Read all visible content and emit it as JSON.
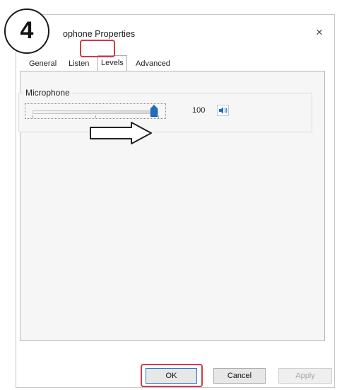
{
  "step_badge": "4",
  "dialog": {
    "title": "ophone Properties",
    "close_label": "×"
  },
  "tabs": [
    {
      "label": "General"
    },
    {
      "label": "Listen"
    },
    {
      "label": "Levels",
      "selected": true
    },
    {
      "label": "Advanced"
    }
  ],
  "levels": {
    "group_label": "Microphone",
    "slider_value": 100,
    "value_text": "100",
    "speaker_icon": "speaker-icon"
  },
  "footer": {
    "ok_label": "OK",
    "cancel_label": "Cancel",
    "apply_label": "Apply"
  },
  "colors": {
    "highlight": "#d2394a",
    "accent": "#1d6fc4"
  }
}
